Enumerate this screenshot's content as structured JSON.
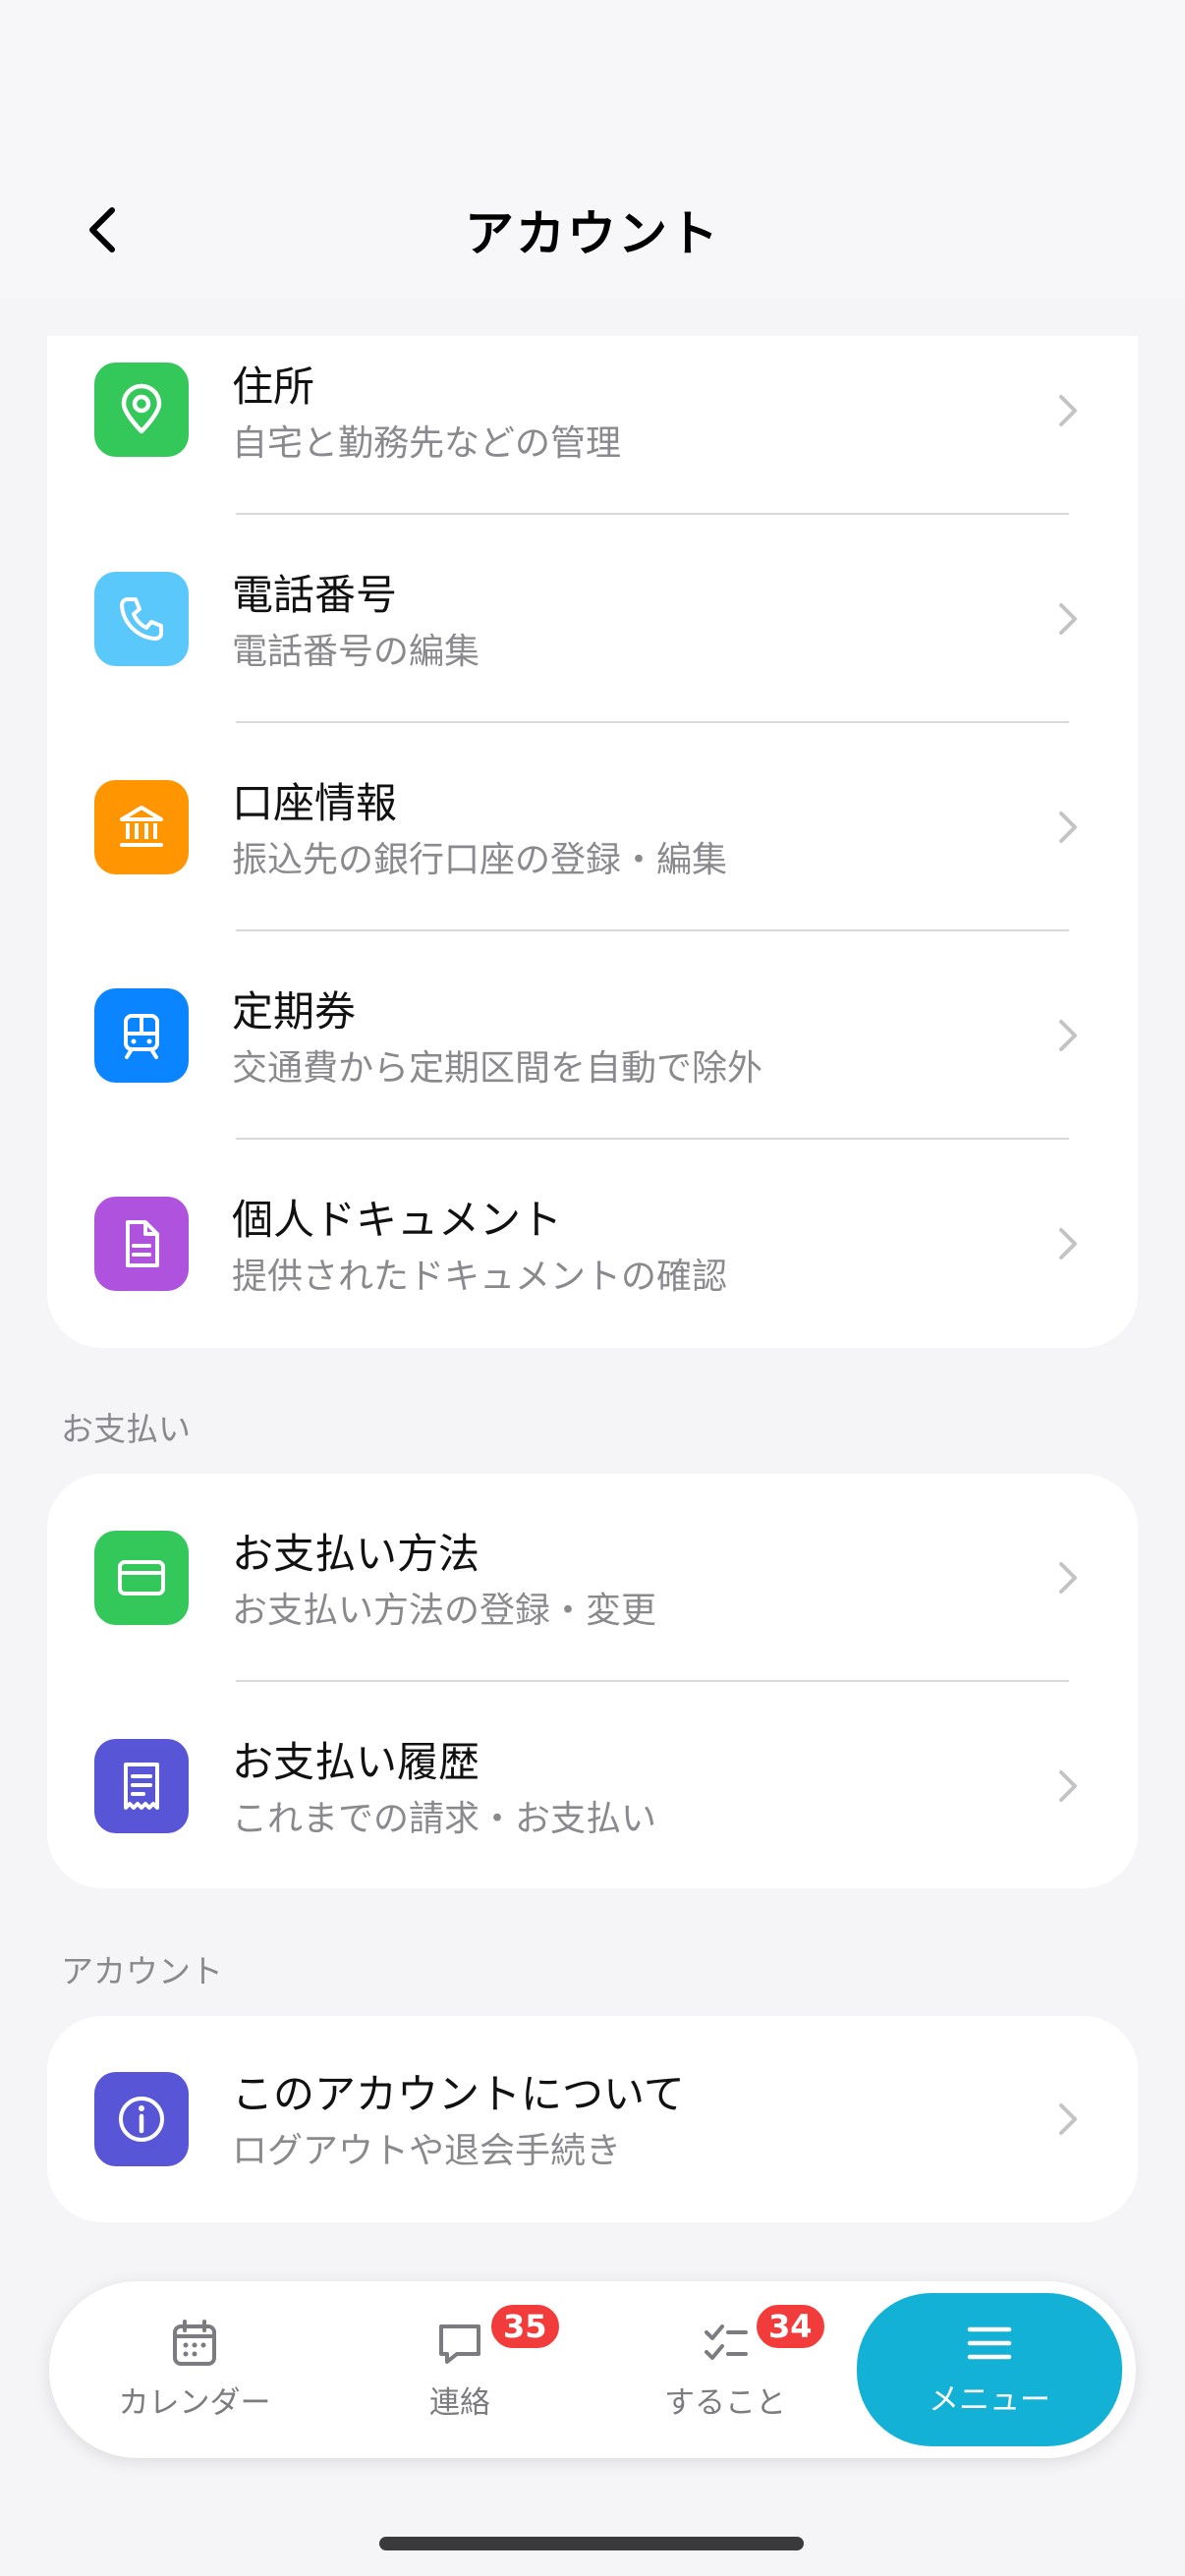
{
  "header": {
    "title": "アカウント"
  },
  "account_items": [
    {
      "title": "住所",
      "subtitle": "自宅と勤務先などの管理",
      "icon": "location-pin-icon",
      "color": "#34c759"
    },
    {
      "title": "電話番号",
      "subtitle": "電話番号の編集",
      "icon": "phone-icon",
      "color": "#5ac8fa"
    },
    {
      "title": "口座情報",
      "subtitle": "振込先の銀行口座の登録・編集",
      "icon": "bank-icon",
      "color": "#ff9500"
    },
    {
      "title": "定期券",
      "subtitle": "交通費から定期区間を自動で除外",
      "icon": "train-icon",
      "color": "#0a84ff"
    },
    {
      "title": "個人ドキュメント",
      "subtitle": "提供されたドキュメントの確認",
      "icon": "document-icon",
      "color": "#af52de"
    }
  ],
  "payment_section": {
    "label": "お支払い",
    "items": [
      {
        "title": "お支払い方法",
        "subtitle": "お支払い方法の登録・変更",
        "icon": "credit-card-icon",
        "color": "#34c759"
      },
      {
        "title": "お支払い履歴",
        "subtitle": "これまでの請求・お支払い",
        "icon": "receipt-icon",
        "color": "#5856d6"
      }
    ]
  },
  "account_section": {
    "label": "アカウント",
    "items": [
      {
        "title": "このアカウントについて",
        "subtitle": "ログアウトや退会手続き",
        "icon": "info-icon",
        "color": "#5856d6"
      }
    ]
  },
  "tabbar": {
    "tabs": [
      {
        "label": "カレンダー",
        "icon": "calendar-icon"
      },
      {
        "label": "連絡",
        "icon": "chat-icon",
        "badge": "35"
      },
      {
        "label": "すること",
        "icon": "checklist-icon",
        "badge": "34"
      },
      {
        "label": "メニュー",
        "icon": "menu-icon"
      }
    ],
    "active_color": "#13b1d6",
    "badge_color": "#f23c3c"
  }
}
